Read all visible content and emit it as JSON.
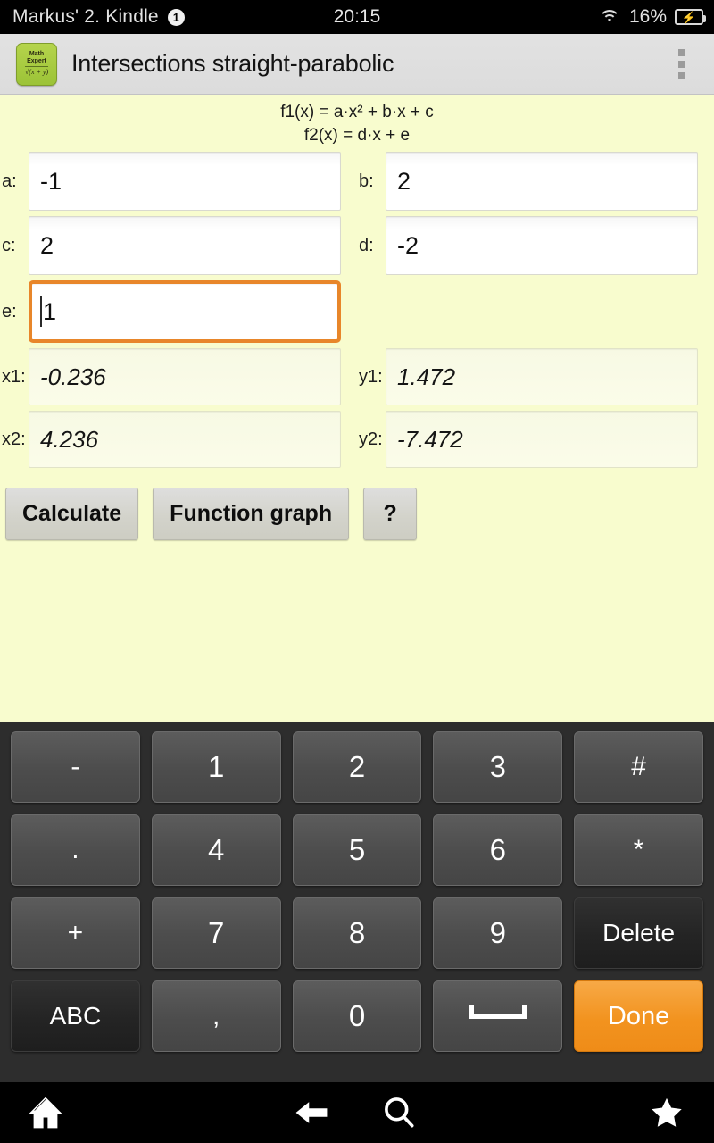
{
  "statusbar": {
    "device": "Markus' 2. Kindle",
    "badge": "1",
    "time": "20:15",
    "battery_percent": "16%",
    "wifi_icon": "wifi-icon",
    "battery_icon": "battery-charging-icon"
  },
  "appbar": {
    "icon": {
      "line1": "Math",
      "line2": "Expert",
      "formula": "√(x + y)"
    },
    "title": "Intersections straight-parabolic",
    "overflow_icon": "overflow-menu-icon"
  },
  "formulas": {
    "f1": "f1(x) = a·x² + b·x + c",
    "f2": "f2(x) = d·x + e"
  },
  "inputs": [
    {
      "label": "a:",
      "value": "-1",
      "focused": false
    },
    {
      "label": "b:",
      "value": "2",
      "focused": false
    },
    {
      "label": "c:",
      "value": "2",
      "focused": false
    },
    {
      "label": "d:",
      "value": "-2",
      "focused": false
    },
    {
      "label": "e:",
      "value": "1",
      "focused": true
    }
  ],
  "results": [
    {
      "label": "x1:",
      "value": "-0.236"
    },
    {
      "label": "y1:",
      "value": "1.472"
    },
    {
      "label": "x2:",
      "value": "4.236"
    },
    {
      "label": "y2:",
      "value": "-7.472"
    }
  ],
  "buttons": [
    {
      "label": "Calculate"
    },
    {
      "label": "Function graph"
    },
    {
      "label": "?"
    }
  ],
  "keyboard": {
    "rows": [
      [
        {
          "label": "-",
          "style": "normal"
        },
        {
          "label": "1",
          "style": "normal"
        },
        {
          "label": "2",
          "style": "normal"
        },
        {
          "label": "3",
          "style": "normal"
        },
        {
          "label": "#",
          "style": "normal"
        }
      ],
      [
        {
          "label": ".",
          "style": "normal"
        },
        {
          "label": "4",
          "style": "normal"
        },
        {
          "label": "5",
          "style": "normal"
        },
        {
          "label": "6",
          "style": "normal"
        },
        {
          "label": "*",
          "style": "normal"
        }
      ],
      [
        {
          "label": "+",
          "style": "normal"
        },
        {
          "label": "7",
          "style": "normal"
        },
        {
          "label": "8",
          "style": "normal"
        },
        {
          "label": "9",
          "style": "normal"
        },
        {
          "label": "Delete",
          "style": "dark"
        }
      ],
      [
        {
          "label": "ABC",
          "style": "dark"
        },
        {
          "label": ",",
          "style": "normal"
        },
        {
          "label": "0",
          "style": "normal"
        },
        {
          "label": "",
          "style": "space"
        },
        {
          "label": "Done",
          "style": "accent"
        }
      ]
    ]
  },
  "navbar": {
    "home_icon": "home-icon",
    "back_icon": "back-arrow-icon",
    "search_icon": "search-icon",
    "star_icon": "star-icon"
  },
  "colors": {
    "background": "#f8fcce",
    "focus_border": "#e8862a",
    "done_key": "#f2931f",
    "app_icon": "#9cc337"
  }
}
